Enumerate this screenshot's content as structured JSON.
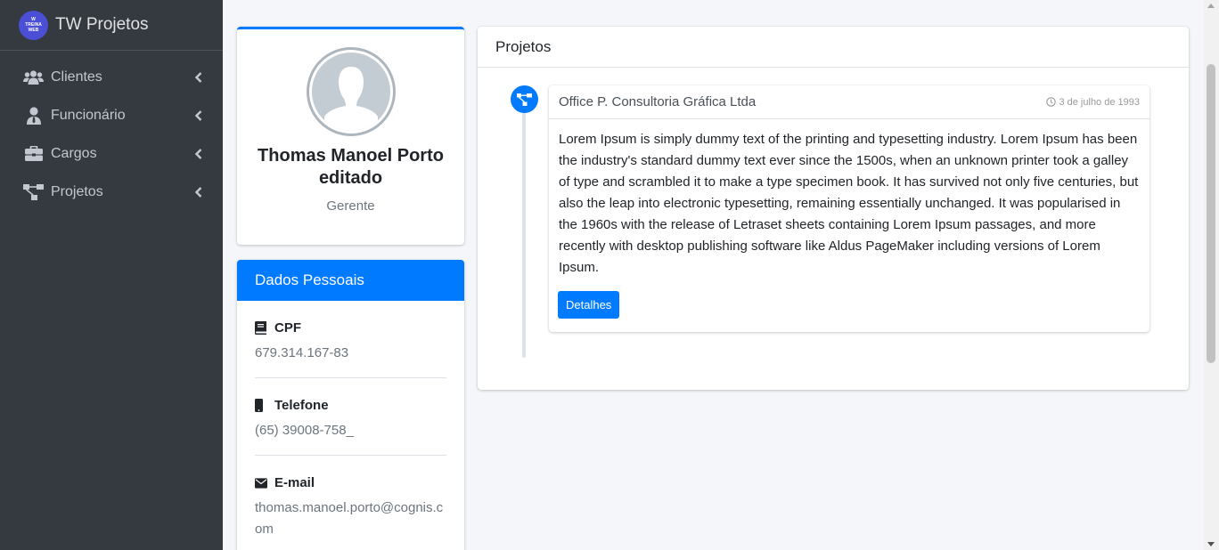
{
  "brand": {
    "logo_line1": "W",
    "logo_line2": "TREINA",
    "logo_line3": "WEB",
    "title": "TW Projetos"
  },
  "sidebar": {
    "items": [
      {
        "label": "Clientes",
        "icon": "users-icon"
      },
      {
        "label": "Funcionário",
        "icon": "user-tie-icon"
      },
      {
        "label": "Cargos",
        "icon": "briefcase-icon"
      },
      {
        "label": "Projetos",
        "icon": "project-diagram-icon"
      }
    ]
  },
  "profile": {
    "name": "Thomas Manoel Porto editado",
    "role": "Gerente"
  },
  "personal": {
    "header": "Dados Pessoais",
    "fields": [
      {
        "label": "CPF",
        "value": "679.314.167-83",
        "icon": "book-icon"
      },
      {
        "label": "Telefone",
        "value": "(65) 39008-758_",
        "icon": "mobile-icon"
      },
      {
        "label": "E-mail",
        "value": "thomas.manoel.porto@cognis.com",
        "icon": "envelope-icon"
      }
    ]
  },
  "projects": {
    "header": "Projetos",
    "items": [
      {
        "title": "Office P. Consultoria Gráfica Ltda",
        "date": "3 de julho de 1993",
        "body": "Lorem Ipsum is simply dummy text of the printing and typesetting industry. Lorem Ipsum has been the industry's standard dummy text ever since the 1500s, when an unknown printer took a galley of type and scrambled it to make a type specimen book. It has survived not only five centuries, but also the leap into electronic typesetting, remaining essentially unchanged. It was popularised in the 1960s with the release of Letraset sheets containing Lorem Ipsum passages, and more recently with desktop publishing software like Aldus PageMaker including versions of Lorem Ipsum.",
        "button": "Detalhes"
      }
    ]
  },
  "colors": {
    "primary": "#007bff",
    "sidebar_bg": "#343a40",
    "page_bg": "#f4f6f9"
  }
}
